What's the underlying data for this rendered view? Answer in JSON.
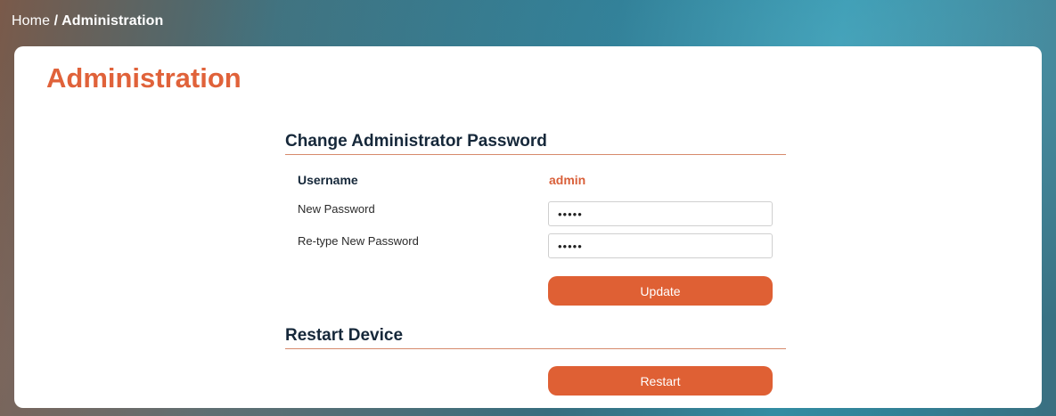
{
  "breadcrumb": {
    "home": "Home",
    "separator": " / ",
    "current": "Administration"
  },
  "page": {
    "title": "Administration"
  },
  "password_section": {
    "title": "Change Administrator Password",
    "username_label": "Username",
    "username_value": "admin",
    "new_password_label": "New Password",
    "new_password_value": "•••••",
    "retype_password_label": "Re-type New Password",
    "retype_password_value": "•••••",
    "update_button": "Update"
  },
  "restart_section": {
    "title": "Restart Device",
    "restart_button": "Restart"
  },
  "colors": {
    "accent": "#df6034",
    "heading": "#16283a"
  }
}
